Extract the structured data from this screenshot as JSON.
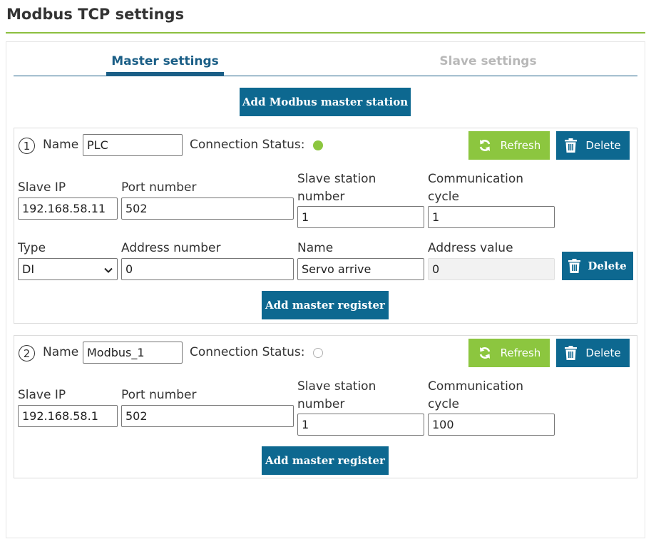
{
  "page": {
    "title": "Modbus TCP settings"
  },
  "tabs": [
    {
      "label": "Master settings",
      "active": true
    },
    {
      "label": "Slave settings",
      "active": false
    }
  ],
  "add_station_label": "Add Modbus master station",
  "labels": {
    "name": "Name",
    "connection_status": "Connection Status:",
    "refresh": "Refresh",
    "delete": "Delete",
    "slave_ip": "Slave IP",
    "port_number": "Port number",
    "slave_station_number": "Slave station number",
    "communication_cycle": "Communication cycle",
    "type": "Type",
    "address_number": "Address number",
    "register_name": "Name",
    "address_value": "Address value",
    "add_register": "Add master register"
  },
  "stations": [
    {
      "number": "1",
      "name": "PLC",
      "status": "connected",
      "slave_ip": "192.168.58.11",
      "port": "502",
      "station_number": "1",
      "cycle": "1",
      "registers": [
        {
          "type": "DI",
          "address_number": "0",
          "name": "Servo arrive",
          "address_value": "0"
        }
      ]
    },
    {
      "number": "2",
      "name": "Modbus_1",
      "status": "disconnected",
      "slave_ip": "192.168.58.1",
      "port": "502",
      "station_number": "1",
      "cycle": "100",
      "registers": []
    }
  ],
  "colors": {
    "accent_blue": "#0d6890",
    "refresh_green": "#8cc63f",
    "title_rule_green": "#8cbf3f",
    "tab_inactive": "#b8b8b8"
  },
  "icons": {
    "refresh": "refresh-icon",
    "delete": "trash-icon",
    "select": "chevron-down-icon"
  }
}
